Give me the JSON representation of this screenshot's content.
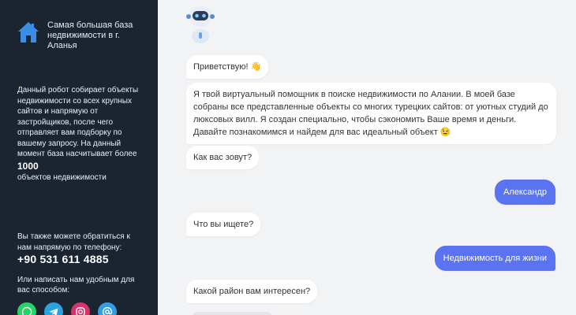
{
  "sidebar": {
    "title": "Самая большая база недвижимости в г. Аланья",
    "description": "Данный робот собирает объекты недвижимости со всех крупных сайтов и напрямую от застройщиков, после чего отправляет вам подборку по вашему запросу. На данный момент база насчитывает более",
    "count": "1000",
    "count_suffix": "объектов недвижимости",
    "contact_text": "Вы также можете обратиться к нам напрямую по телефону:",
    "phone": "+90 531 611 4885",
    "write_text": "Или написать нам удобным для вас способом:",
    "socials": [
      {
        "icon": "whatsapp-icon",
        "color": "#25d366"
      },
      {
        "icon": "telegram-icon",
        "color": "#2aa3df"
      },
      {
        "icon": "instagram-icon",
        "color": "#d6336c"
      },
      {
        "icon": "email-icon",
        "color": "#2f9ee6"
      }
    ]
  },
  "chat": {
    "messages": [
      {
        "from": "bot",
        "text": "Приветствую! 👋"
      },
      {
        "from": "bot",
        "text": "Я твой виртуальный помощник в поиске недвижимости по Алании. В моей базе собраны все представленные объекты со многих турецких сайтов: от уютных студий до люксовых вилл. Я создан специально, чтобы сэкономить Ваше время и деньги. Давайте познакомимся и найдем для вас идеальный объект 😉"
      },
      {
        "from": "bot",
        "text": "Как вас зовут?"
      },
      {
        "from": "user",
        "text": "Александр"
      },
      {
        "from": "bot",
        "text": "Что вы ищете?"
      },
      {
        "from": "user",
        "text": "Недвижимость для жизни"
      },
      {
        "from": "bot",
        "text": "Какой район вам интересен?"
      }
    ]
  }
}
